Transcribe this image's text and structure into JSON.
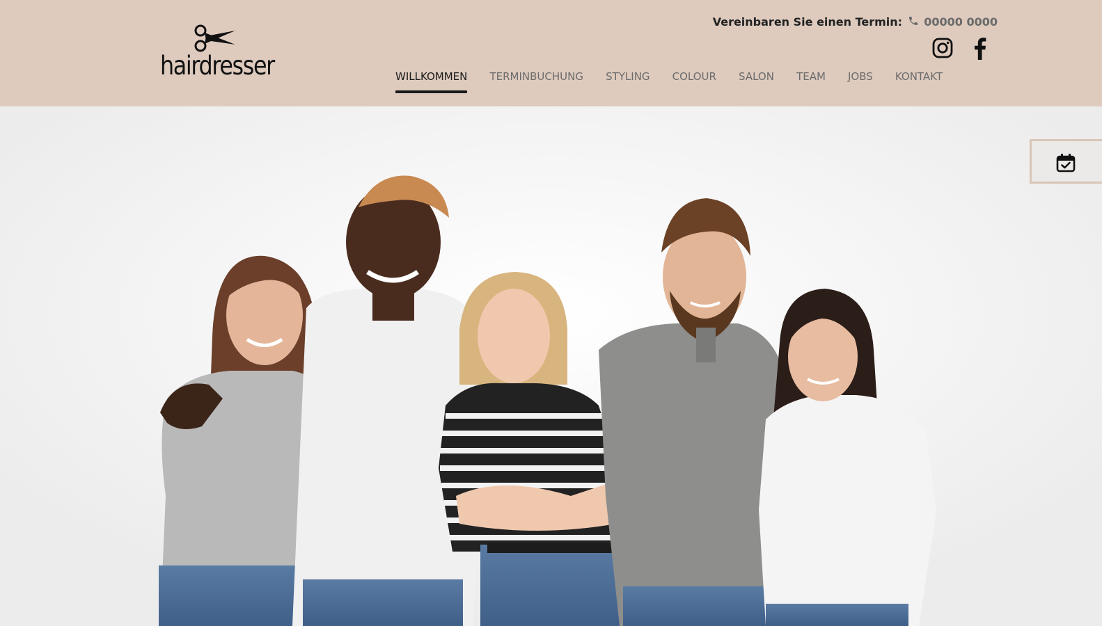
{
  "header": {
    "logo": {
      "text": "hairdresser",
      "icon": "scissors-icon"
    },
    "appointment": {
      "label": "Vereinbaren Sie einen Termin:",
      "phone_icon": "phone-icon",
      "phone": "00000 0000"
    },
    "social": [
      {
        "name": "Instagram",
        "icon": "instagram-icon"
      },
      {
        "name": "Facebook",
        "icon": "facebook-icon"
      }
    ],
    "nav": [
      {
        "label": "WILLKOMMEN",
        "active": true
      },
      {
        "label": "TERMINBUCHUNG",
        "active": false
      },
      {
        "label": "STYLING",
        "active": false
      },
      {
        "label": "COLOUR",
        "active": false
      },
      {
        "label": "SALON",
        "active": false
      },
      {
        "label": "TEAM",
        "active": false
      },
      {
        "label": "JOBS",
        "active": false
      },
      {
        "label": "KONTAKT",
        "active": false
      }
    ]
  },
  "booking_tab": {
    "icon": "calendar-check-icon"
  },
  "colors": {
    "header_bg": "#decbbe",
    "nav_text": "#6b6b6b",
    "nav_active": "#1a1a1a",
    "booking_border": "#d8c5b6"
  }
}
